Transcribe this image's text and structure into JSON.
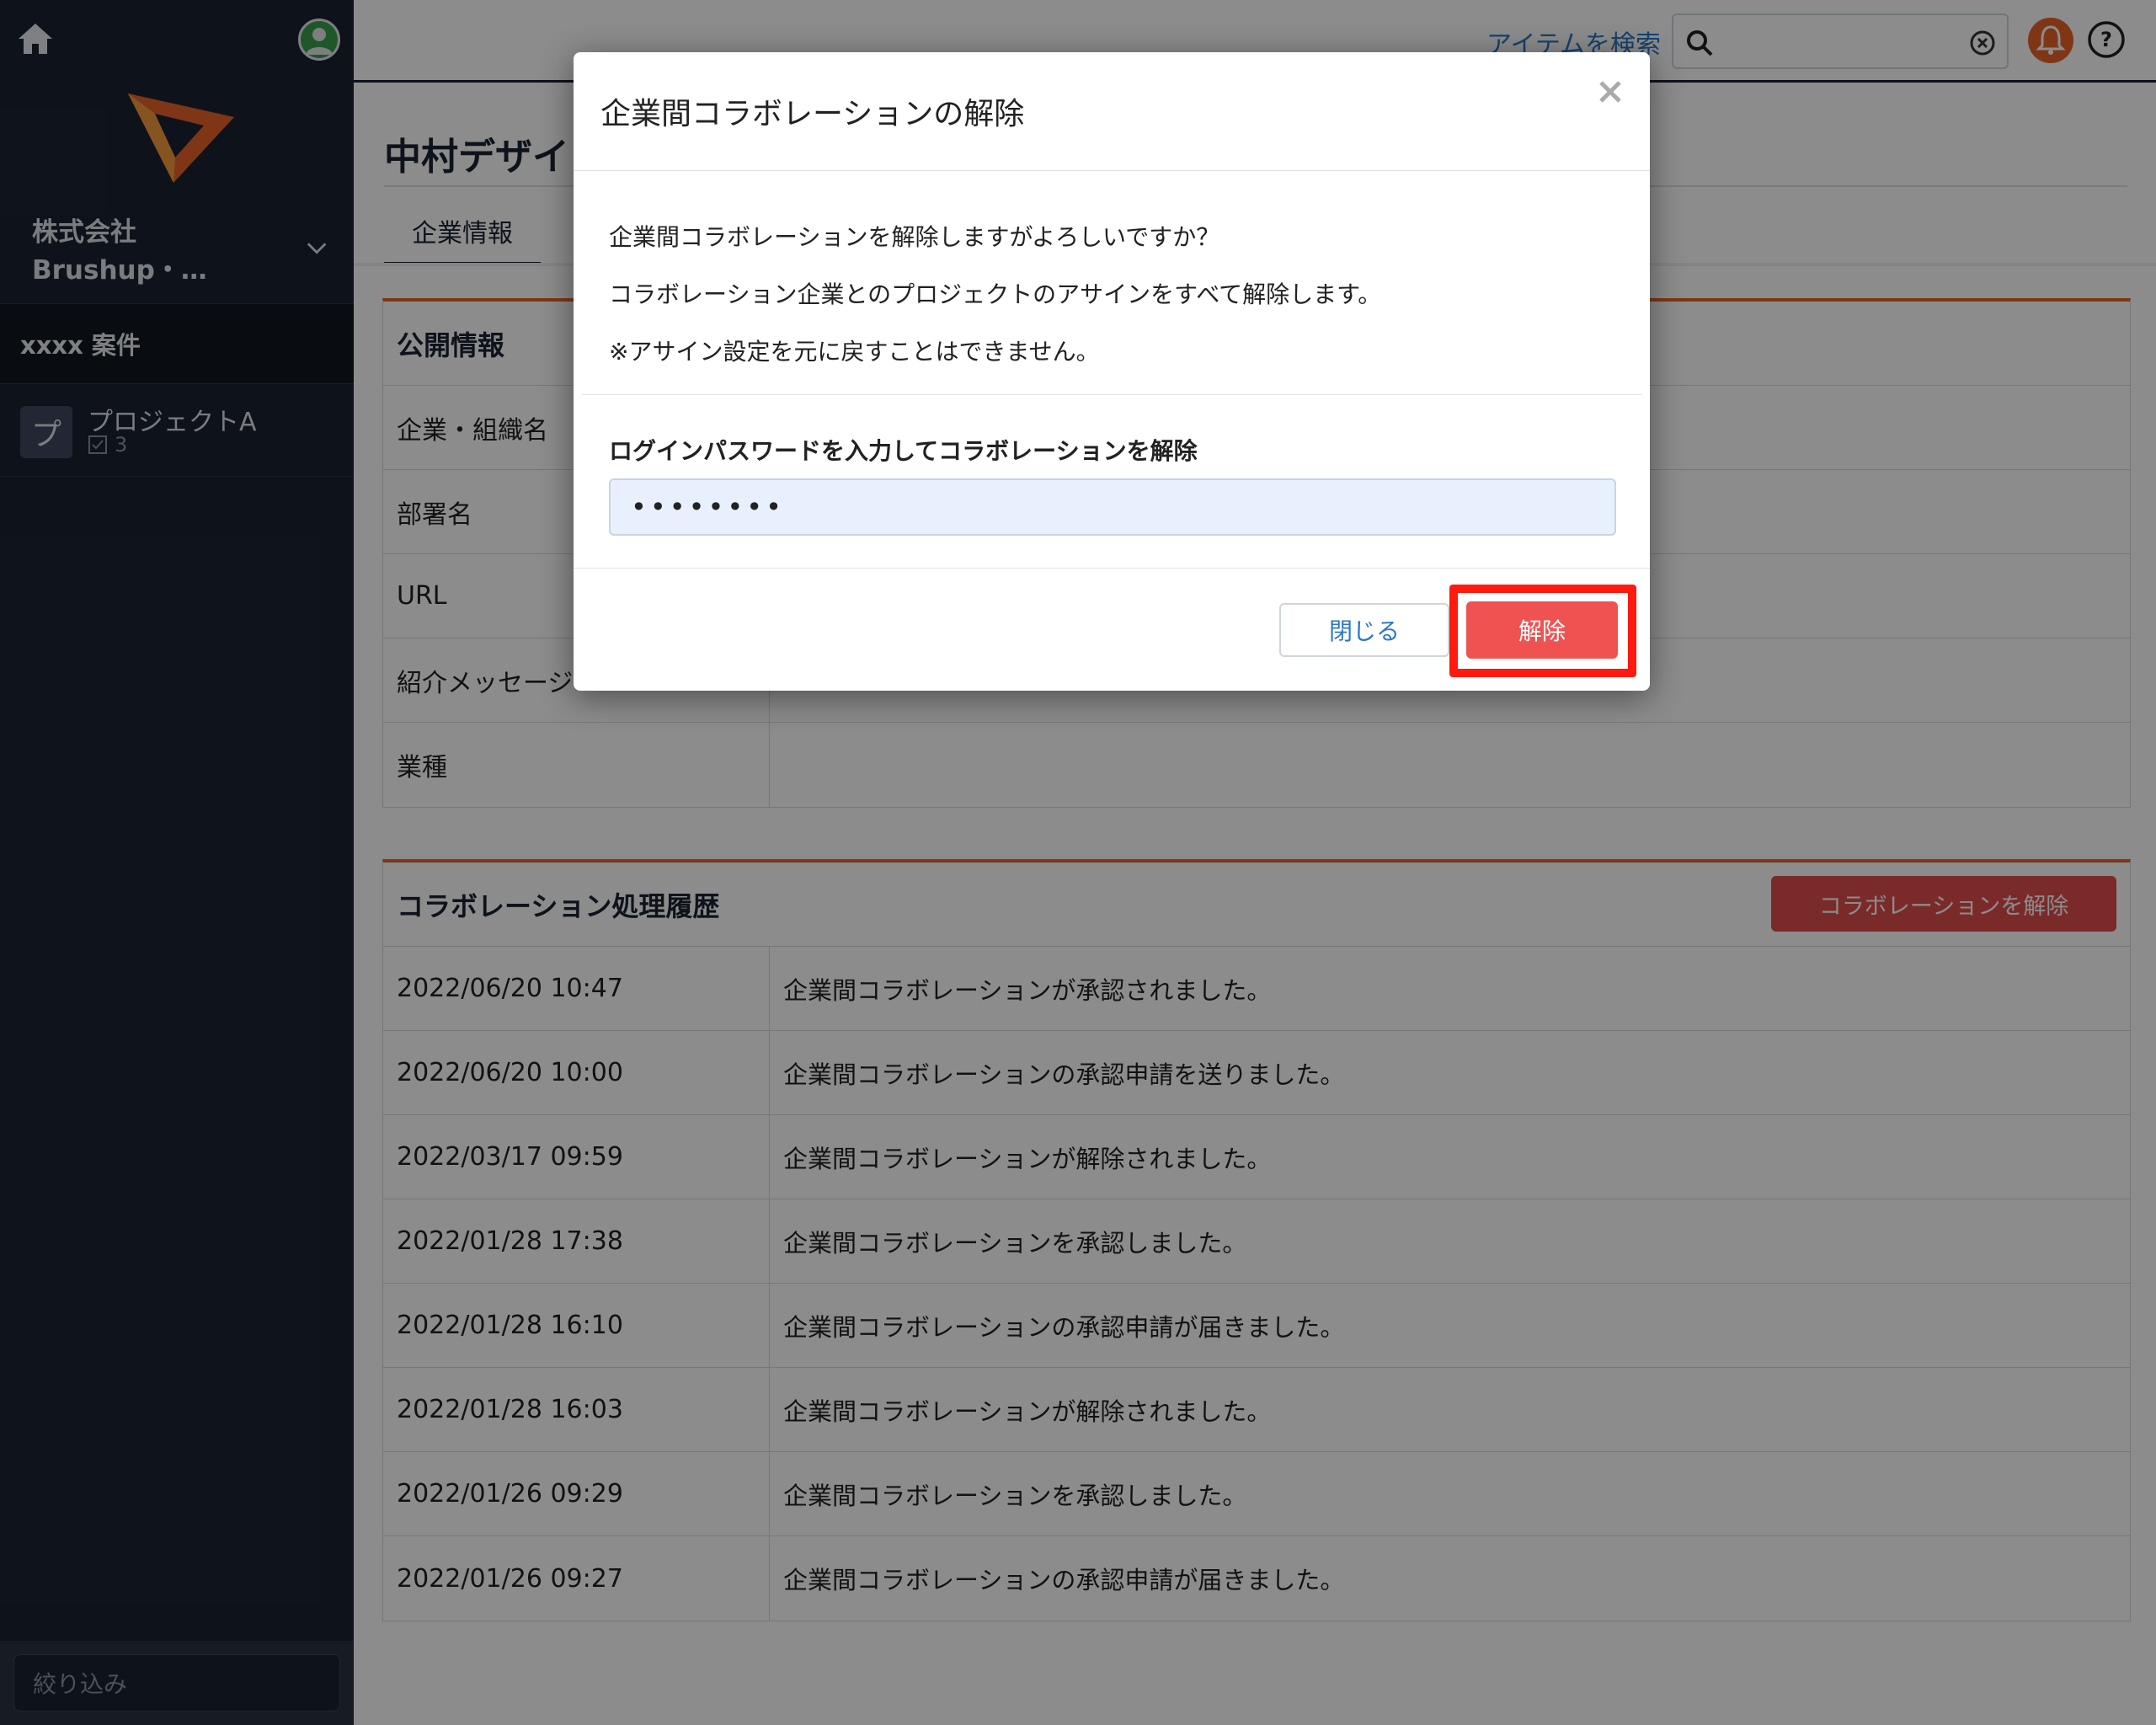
{
  "sidebar": {
    "company_name": "株式会社Brushup・…",
    "section_title": "xxxx 案件",
    "project": {
      "avatar_letter": "プ",
      "name": "プロジェクトA",
      "task_count": "3"
    },
    "filter_placeholder": "絞り込み"
  },
  "topbar": {
    "search_link": "アイテムを検索",
    "search_value": ""
  },
  "page": {
    "title": "中村デザイン",
    "tab_label": "企業情報"
  },
  "public_info": {
    "heading": "公開情報",
    "rows": [
      {
        "label": "企業・組織名",
        "value": ""
      },
      {
        "label": "部署名",
        "value": ""
      },
      {
        "label": "URL",
        "value": ""
      },
      {
        "label": "紹介メッセージ",
        "value": ""
      },
      {
        "label": "業種",
        "value": ""
      }
    ]
  },
  "history": {
    "heading": "コラボレーション処理履歴",
    "release_button": "コラボレーションを解除",
    "rows": [
      {
        "date": "2022/06/20 10:47",
        "event": "企業間コラボレーションが承認されました。"
      },
      {
        "date": "2022/06/20 10:00",
        "event": "企業間コラボレーションの承認申請を送りました。"
      },
      {
        "date": "2022/03/17 09:59",
        "event": "企業間コラボレーションが解除されました。"
      },
      {
        "date": "2022/01/28 17:38",
        "event": "企業間コラボレーションを承認しました。"
      },
      {
        "date": "2022/01/28 16:10",
        "event": "企業間コラボレーションの承認申請が届きました。"
      },
      {
        "date": "2022/01/28 16:03",
        "event": "企業間コラボレーションが解除されました。"
      },
      {
        "date": "2022/01/26 09:29",
        "event": "企業間コラボレーションを承認しました。"
      },
      {
        "date": "2022/01/26 09:27",
        "event": "企業間コラボレーションの承認申請が届きました。"
      }
    ]
  },
  "modal": {
    "title": "企業間コラボレーションの解除",
    "messages": [
      "企業間コラボレーションを解除しますがよろしいですか？",
      "コラボレーション企業とのプロジェクトのアサインをすべて解除します。",
      "※アサイン設定を元に戻すことはできません。"
    ],
    "password_label": "ログインパスワードを入力してコラボレーションを解除",
    "password_value": "••••••••",
    "close_button": "閉じる",
    "confirm_button": "解除"
  },
  "colors": {
    "accent_orange": "#e8632b",
    "danger_red": "#f05252",
    "highlight_red": "#ff1a0f",
    "sidebar_bg": "#1b2432",
    "link_blue": "#2a78c5"
  },
  "icons": [
    "home-icon",
    "user-icon",
    "logo-icon",
    "chevron-down-icon",
    "task-icon",
    "search-icon",
    "clear-icon",
    "bell-icon",
    "help-icon",
    "close-icon"
  ]
}
